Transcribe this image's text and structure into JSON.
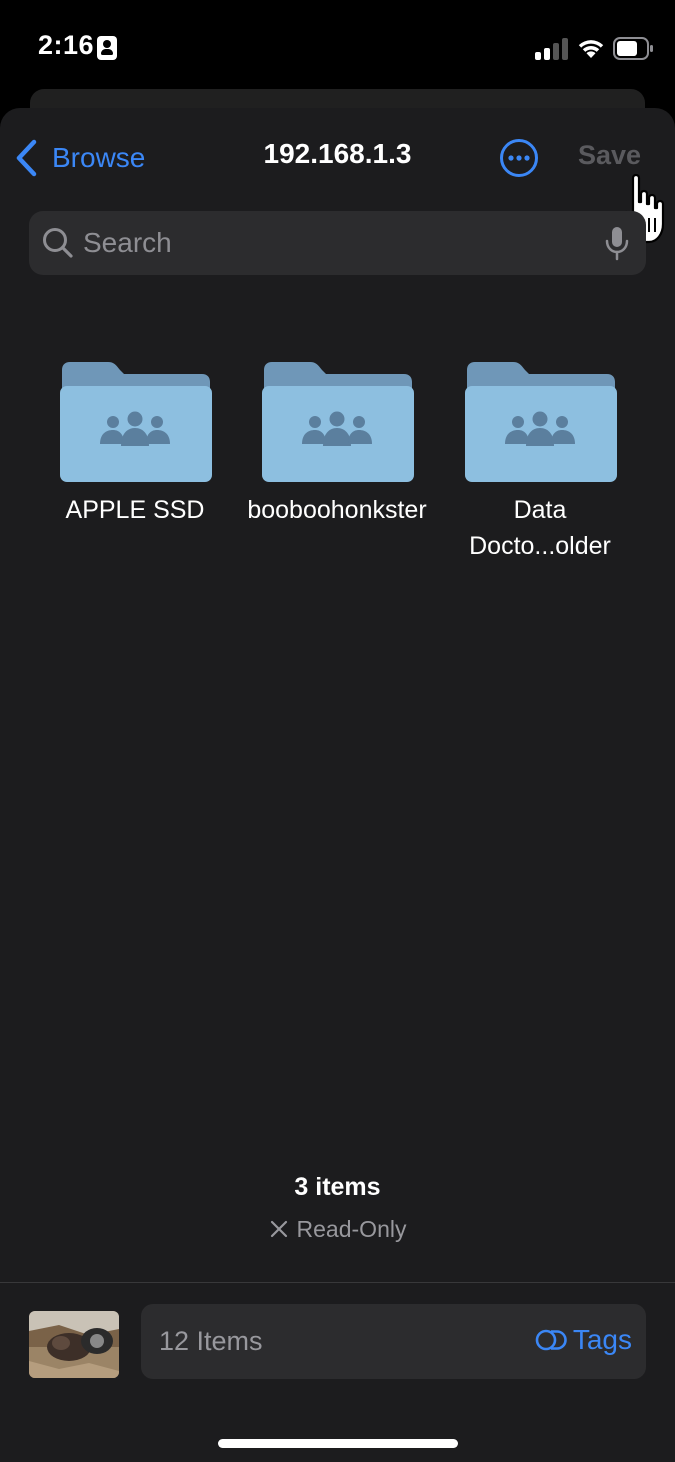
{
  "status_bar": {
    "time": "2:16"
  },
  "nav": {
    "back_label": "Browse",
    "title": "192.168.1.3",
    "save_label": "Save",
    "more_icon": "ellipsis-circle-icon"
  },
  "search": {
    "placeholder": "Search",
    "value": ""
  },
  "folders": [
    {
      "name": "APPLE SSD",
      "icon": "shared-folder-icon"
    },
    {
      "name": "booboohonkster",
      "icon": "shared-folder-icon"
    },
    {
      "name": "Data Docto...older",
      "icon": "shared-folder-icon"
    }
  ],
  "footer": {
    "items_count": "3 items",
    "status": "Read-Only"
  },
  "bottom_bar": {
    "items_label": "12 Items",
    "tags_label": "Tags"
  },
  "colors": {
    "accent": "#3b87f6",
    "background": "#1c1c1e",
    "folder_front": "#8dbfe0",
    "folder_back": "#6f97b8"
  }
}
